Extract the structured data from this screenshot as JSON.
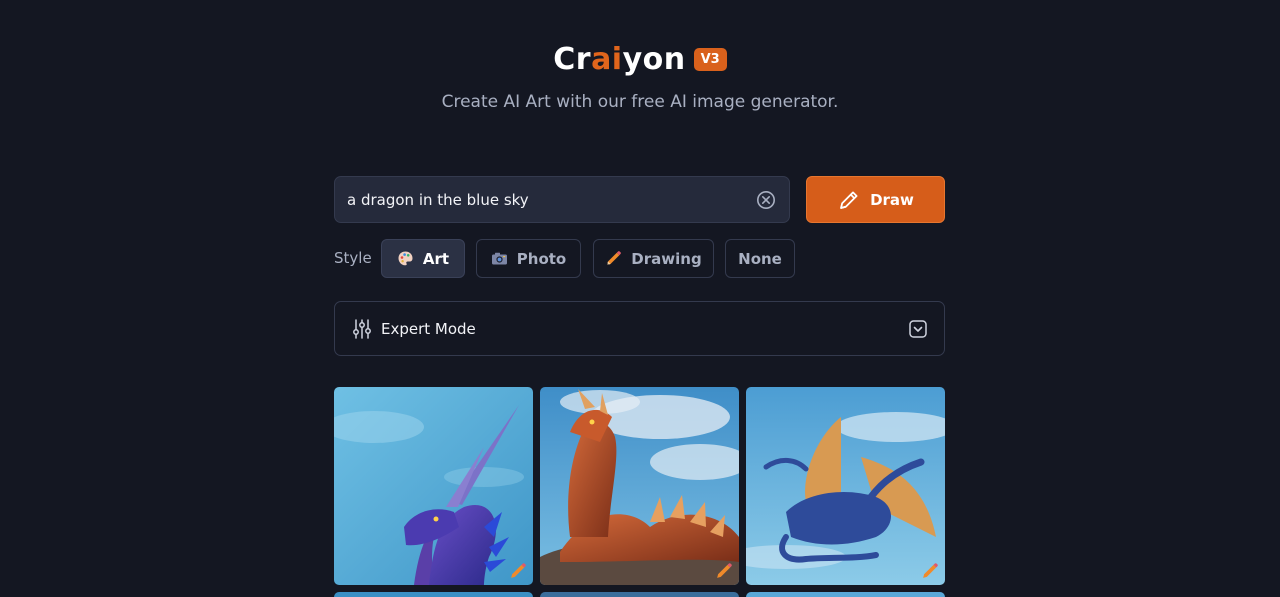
{
  "header": {
    "logo_part1": "Cr",
    "logo_part2": "ai",
    "logo_part3": "yon",
    "version": "V3",
    "tagline": "Create AI Art with our free AI image generator."
  },
  "prompt": {
    "value": "a dragon in the blue sky",
    "clear_icon": "close-circle-icon"
  },
  "draw_button": {
    "label": "Draw",
    "icon": "pencil-icon"
  },
  "style": {
    "label": "Style",
    "options": [
      {
        "label": "Art",
        "icon": "palette-icon",
        "active": true
      },
      {
        "label": "Photo",
        "icon": "camera-icon",
        "active": false
      },
      {
        "label": "Drawing",
        "icon": "pencil-icon",
        "active": false
      },
      {
        "label": "None",
        "icon": "",
        "active": false
      }
    ]
  },
  "expert_mode": {
    "label": "Expert Mode",
    "icon": "sliders-icon",
    "toggle_icon": "chevron-down-icon"
  },
  "images": [
    {
      "alt": "purple dragon head with horns",
      "palette": "#5aaed6"
    },
    {
      "alt": "red dragon sitting on rock",
      "palette": "#4c9ed0"
    },
    {
      "alt": "blue dragon flying with orange wings",
      "palette": "#47a6d6"
    }
  ],
  "colors": {
    "background": "#141722",
    "accent": "#d65d1a",
    "input_bg": "#252a3b",
    "border": "#343a4e"
  }
}
